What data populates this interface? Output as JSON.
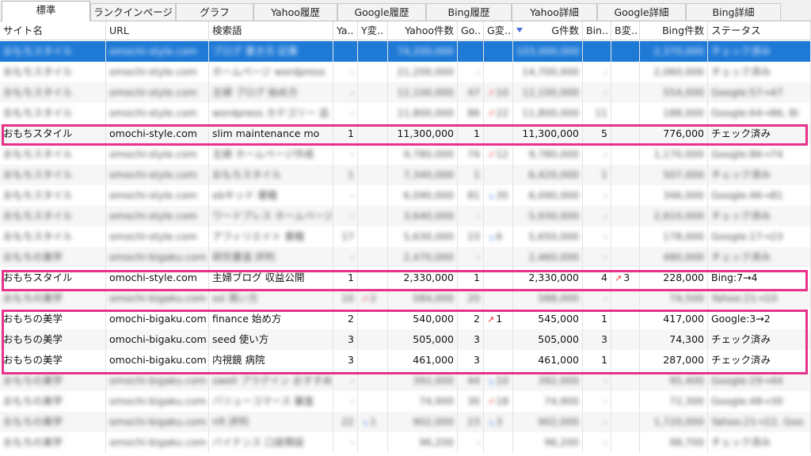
{
  "tabs": [
    "標準",
    "ランクインページ",
    "グラフ",
    "Yahoo履歴",
    "Google履歴",
    "Bing履歴",
    "Yahoo詳細",
    "Google詳細",
    "Bing詳細"
  ],
  "columns": {
    "site": "サイト名",
    "url": "URL",
    "keyword": "検索語",
    "ya": "Ya..",
    "ych": "Y変..",
    "ycount": "Yahoo件数",
    "go": "Go..",
    "gch": "G変..",
    "gcount": "G件数",
    "bin": "Bin..",
    "bch": "B変..",
    "bcount": "Bing件数",
    "status": "ステータス"
  },
  "rows": [
    {
      "site": "おもちスタイル",
      "url": "omochi-style.com",
      "keyword": "ブログ 書き方 記事",
      "ya": "",
      "ych": "",
      "ycount": "74,200,000",
      "go": "",
      "gch": "",
      "gcount": "103,000,000",
      "bin": "",
      "bch": "",
      "bcount": "2,370,000",
      "status": "チェック済み"
    },
    {
      "site": "おもちスタイル",
      "url": "omochi-style.com",
      "keyword": "ホームページ wordpress",
      "ya": "-",
      "ych": "",
      "ycount": "21,200,000",
      "go": "-",
      "gch": "",
      "gcount": "14,700,000",
      "bin": "-",
      "bch": "",
      "bcount": "2,060,000",
      "status": "チェック済み"
    },
    {
      "site": "おもちスタイル",
      "url": "omochi-style.com",
      "keyword": "主婦 ブログ 始め方",
      "ya": "-",
      "ych": "",
      "ycount": "12,100,000",
      "go": "47",
      "gch": "10",
      "gcount": "12,100,000",
      "bin": "-",
      "bch": "",
      "bcount": "554,000",
      "status": "Google:57→47"
    },
    {
      "site": "おもちスタイル",
      "url": "omochi-style.com",
      "keyword": "wordpress カテゴリー 追",
      "ya": "-",
      "ych": "",
      "ycount": "11,800,000",
      "go": "86",
      "gch": "22",
      "gcount": "11,800,000",
      "bin": "11",
      "bch": "",
      "bcount": "188,000",
      "status": "Google:64→86, Bi"
    },
    {
      "site": "おもちスタイル",
      "url": "omochi-style.com",
      "keyword": "slim maintenance mo",
      "ya": "1",
      "ych": "",
      "ycount": "11,300,000",
      "go": "1",
      "gch": "",
      "gcount": "11,300,000",
      "bin": "5",
      "bch": "",
      "bcount": "776,000",
      "status": "チェック済み"
    },
    {
      "site": "おもちスタイル",
      "url": "omochi-style.com",
      "keyword": "主婦 ホームページ作成",
      "ya": "-",
      "ych": "",
      "ycount": "9,780,000",
      "go": "74",
      "gch": "12",
      "gcount": "9,780,000",
      "bin": "-",
      "bch": "",
      "bcount": "1,170,000",
      "status": "Google:86→74"
    },
    {
      "site": "おもちスタイル",
      "url": "omochi-style.com",
      "keyword": "おもちスタイル",
      "ya": "1",
      "ych": "",
      "ycount": "7,340,000",
      "go": "1",
      "gch": "",
      "gcount": "6,420,000",
      "bin": "1",
      "bch": "",
      "bcount": "507,000",
      "status": "チェック済み"
    },
    {
      "site": "おもちスタイル",
      "url": "omochi-style.com",
      "keyword": "ebキッド 書籍",
      "ya": "-",
      "ych": "",
      "ycount": "6,090,000",
      "go": "81",
      "gch": "35",
      "gcount": "6,090,000",
      "bin": "-",
      "bch": "",
      "bcount": "346,000",
      "status": "Google:46→81"
    },
    {
      "site": "おもちスタイル",
      "url": "omochi-style.com",
      "keyword": "ワードプレス ホームページ",
      "ya": "-",
      "ych": "",
      "ycount": "3,640,000",
      "go": "-",
      "gch": "",
      "gcount": "5,930,000",
      "bin": "-",
      "bch": "",
      "bcount": "2,810,000",
      "status": "チェック済み"
    },
    {
      "site": "おもちスタイル",
      "url": "omochi-style.com",
      "keyword": "アフィリエイト 書籍",
      "ya": "17",
      "ych": "",
      "ycount": "5,630,000",
      "go": "23",
      "gch": "6",
      "gcount": "5,650,000",
      "bin": "-",
      "bch": "",
      "bcount": "178,000",
      "status": "Google:17→23"
    },
    {
      "site": "おもちの美学",
      "url": "omochi-bigaku.com",
      "keyword": "研究書道 評判",
      "ya": "-",
      "ych": "",
      "ycount": "2,470,000",
      "go": "-",
      "gch": "",
      "gcount": "2,460,000",
      "bin": "-",
      "bch": "",
      "bcount": "480,000",
      "status": "チェック済み"
    },
    {
      "site": "おもちスタイル",
      "url": "omochi-style.com",
      "keyword": "主婦ブログ 収益公開",
      "ya": "1",
      "ych": "",
      "ycount": "2,330,000",
      "go": "1",
      "gch": "",
      "gcount": "2,330,000",
      "bin": "4",
      "bch": "3",
      "bcount": "228,000",
      "status": "Bing:7→4"
    },
    {
      "site": "おもちの美学",
      "url": "omochi-bigaku.com",
      "keyword": "ssl 買い方",
      "ya": "10",
      "ych": "2",
      "ycount": "584,000",
      "go": "20",
      "gch": "",
      "gcount": "588,000",
      "bin": "-",
      "bch": "",
      "bcount": "74,500",
      "status": "Yahoo:21→10"
    },
    {
      "site": "おもちの美学",
      "url": "omochi-bigaku.com",
      "keyword": "finance 始め方",
      "ya": "2",
      "ych": "",
      "ycount": "540,000",
      "go": "2",
      "gch": "1",
      "gcount": "545,000",
      "bin": "1",
      "bch": "",
      "bcount": "417,000",
      "status": "Google:3→2"
    },
    {
      "site": "おもちの美学",
      "url": "omochi-bigaku.com",
      "keyword": "seed 使い方",
      "ya": "3",
      "ych": "",
      "ycount": "505,000",
      "go": "3",
      "gch": "",
      "gcount": "505,000",
      "bin": "3",
      "bch": "",
      "bcount": "74,300",
      "status": "チェック済み"
    },
    {
      "site": "おもちの美学",
      "url": "omochi-bigaku.com",
      "keyword": "内視鏡 病院",
      "ya": "3",
      "ych": "",
      "ycount": "461,000",
      "go": "3",
      "gch": "",
      "gcount": "461,000",
      "bin": "1",
      "bch": "",
      "bcount": "287,000",
      "status": "チェック済み"
    },
    {
      "site": "おもちの美学",
      "url": "omochi-bigaku.com",
      "keyword": "swell プラグイン おすすめ",
      "ya": "-",
      "ych": "",
      "ycount": "392,000",
      "go": "44",
      "gch": "10",
      "gcount": "392,000",
      "bin": "-",
      "bch": "",
      "bcount": "95,400",
      "status": "Google:29→44"
    },
    {
      "site": "おもちの美学",
      "url": "omochi-bigaku.com",
      "keyword": "バリューコマース 審査",
      "ya": "-",
      "ych": "",
      "ycount": "74,900",
      "go": "30",
      "gch": "18",
      "gcount": "74,900",
      "bin": "-",
      "bch": "",
      "bcount": "72,300",
      "status": "Google:48→30"
    },
    {
      "site": "おもちの美学",
      "url": "omochi-bigaku.com",
      "keyword": "nft 評判",
      "ya": "22",
      "ych": "1",
      "ycount": "902,000",
      "go": "23",
      "gch": "3",
      "gcount": "902,000",
      "bin": "-",
      "bch": "",
      "bcount": "1,720,000",
      "status": "Yahoo:21→22, Goo"
    },
    {
      "site": "おもちの美学",
      "url": "omochi-bigaku.com",
      "keyword": "バイナンス 口座開設",
      "ya": "-",
      "ych": "",
      "ycount": "96,200",
      "go": "-",
      "gch": "",
      "gcount": "96,200",
      "bin": "-",
      "bch": "",
      "bcount": "98,700",
      "status": "チェック済み"
    }
  ]
}
